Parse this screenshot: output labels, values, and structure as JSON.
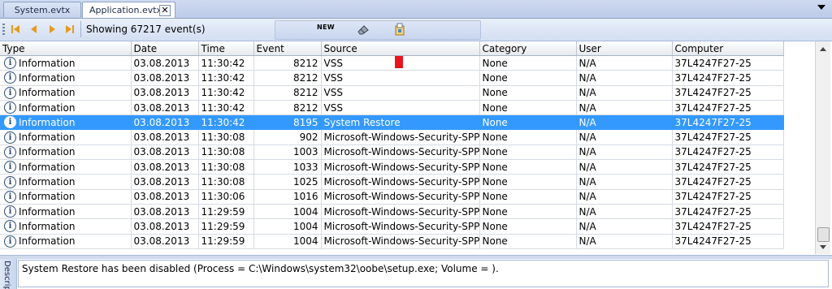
{
  "tabs": [
    {
      "label": "System.evtx",
      "active": false
    },
    {
      "label": "Application.evtx",
      "active": true
    }
  ],
  "tab_close_label": "✕",
  "toolbar": {
    "status": "Showing 67217 event(s)",
    "new_label": "NEW"
  },
  "columns": [
    "Type",
    "Date",
    "Time",
    "Event",
    "Source",
    "Category",
    "User",
    "Computer"
  ],
  "rows": [
    {
      "type": "Information",
      "date": "03.08.2013",
      "time": "11:30:42",
      "event": "8212",
      "source": "VSS",
      "category": "None",
      "user": "N/A",
      "computer": "37L4247F27-25",
      "selected": false
    },
    {
      "type": "Information",
      "date": "03.08.2013",
      "time": "11:30:42",
      "event": "8212",
      "source": "VSS",
      "category": "None",
      "user": "N/A",
      "computer": "37L4247F27-25",
      "selected": false
    },
    {
      "type": "Information",
      "date": "03.08.2013",
      "time": "11:30:42",
      "event": "8212",
      "source": "VSS",
      "category": "None",
      "user": "N/A",
      "computer": "37L4247F27-25",
      "selected": false
    },
    {
      "type": "Information",
      "date": "03.08.2013",
      "time": "11:30:42",
      "event": "8212",
      "source": "VSS",
      "category": "None",
      "user": "N/A",
      "computer": "37L4247F27-25",
      "selected": false
    },
    {
      "type": "Information",
      "date": "03.08.2013",
      "time": "11:30:42",
      "event": "8195",
      "source": "System Restore",
      "category": "None",
      "user": "N/A",
      "computer": "37L4247F27-25",
      "selected": true
    },
    {
      "type": "Information",
      "date": "03.08.2013",
      "time": "11:30:08",
      "event": "902",
      "source": "Microsoft-Windows-Security-SPP",
      "category": "None",
      "user": "N/A",
      "computer": "37L4247F27-25",
      "selected": false
    },
    {
      "type": "Information",
      "date": "03.08.2013",
      "time": "11:30:08",
      "event": "1003",
      "source": "Microsoft-Windows-Security-SPP",
      "category": "None",
      "user": "N/A",
      "computer": "37L4247F27-25",
      "selected": false
    },
    {
      "type": "Information",
      "date": "03.08.2013",
      "time": "11:30:08",
      "event": "1033",
      "source": "Microsoft-Windows-Security-SPP",
      "category": "None",
      "user": "N/A",
      "computer": "37L4247F27-25",
      "selected": false
    },
    {
      "type": "Information",
      "date": "03.08.2013",
      "time": "11:30:08",
      "event": "1025",
      "source": "Microsoft-Windows-Security-SPP",
      "category": "None",
      "user": "N/A",
      "computer": "37L4247F27-25",
      "selected": false
    },
    {
      "type": "Information",
      "date": "03.08.2013",
      "time": "11:30:06",
      "event": "1016",
      "source": "Microsoft-Windows-Security-SPP",
      "category": "None",
      "user": "N/A",
      "computer": "37L4247F27-25",
      "selected": false
    },
    {
      "type": "Information",
      "date": "03.08.2013",
      "time": "11:29:59",
      "event": "1004",
      "source": "Microsoft-Windows-Security-SPP",
      "category": "None",
      "user": "N/A",
      "computer": "37L4247F27-25",
      "selected": false
    },
    {
      "type": "Information",
      "date": "03.08.2013",
      "time": "11:29:59",
      "event": "1004",
      "source": "Microsoft-Windows-Security-SPP",
      "category": "None",
      "user": "N/A",
      "computer": "37L4247F27-25",
      "selected": false
    },
    {
      "type": "Information",
      "date": "03.08.2013",
      "time": "11:29:59",
      "event": "1004",
      "source": "Microsoft-Windows-Security-SPP",
      "category": "None",
      "user": "N/A",
      "computer": "37L4247F27-25",
      "selected": false
    }
  ],
  "description": {
    "side_label": "Description",
    "text": "System Restore has been disabled (Process = C:\\Windows\\system32\\oobe\\setup.exe; Volume = )."
  },
  "colors": {
    "selection": "#3399ff",
    "annotation_arrow": "#e8141c"
  }
}
